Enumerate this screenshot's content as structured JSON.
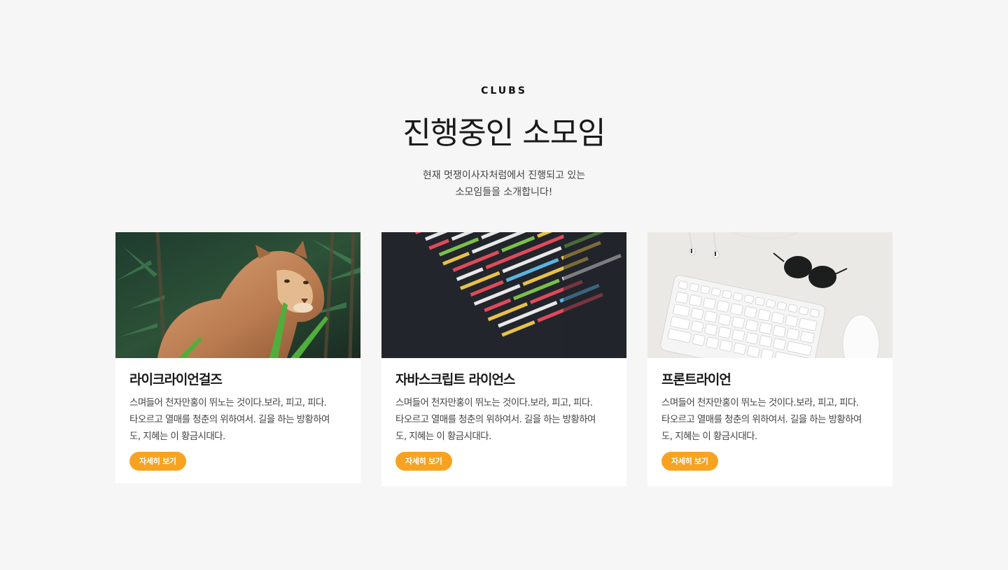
{
  "section": {
    "eyebrow": "CLUBS",
    "title": "진행중인 소모임",
    "description_line1": "현재 멋쟁이사자처럼에서 진행되고 있는",
    "description_line2": "소모임들을 소개합니다!"
  },
  "cards": [
    {
      "image": "lioness-photo",
      "title": "라이크라이언걸즈",
      "text_line1": "스며들어 천자만홍이 뛰노는 것이다.보라, 피고, 피다.",
      "text_line2": "타오르고 열매를 청춘의 위하여서. 길을 하는 방황하여",
      "text_line3": "도, 지혜는 이 황금시대다.",
      "button": "자세히 보기"
    },
    {
      "image": "code-screen-photo",
      "title": "자바스크립트 라이언스",
      "text_line1": "스며들어 천자만홍이 뛰노는 것이다.보라, 피고, 피다.",
      "text_line2": "타오르고 열매를 청춘의 위하여서. 길을 하는 방황하여",
      "text_line3": "도, 지혜는 이 황금시대다.",
      "button": "자세히 보기"
    },
    {
      "image": "keyboard-desk-photo",
      "title": "프론트라이언",
      "text_line1": "스며들어 천자만홍이 뛰노는 것이다.보라, 피고, 피다.",
      "text_line2": "타오르고 열매를 청춘의 위하여서. 길을 하는 방황하여",
      "text_line3": "도, 지혜는 이 황금시대다.",
      "button": "자세히 보기"
    }
  ],
  "colors": {
    "background": "#f6f6f6",
    "accent": "#f7a321",
    "card": "#ffffff"
  }
}
